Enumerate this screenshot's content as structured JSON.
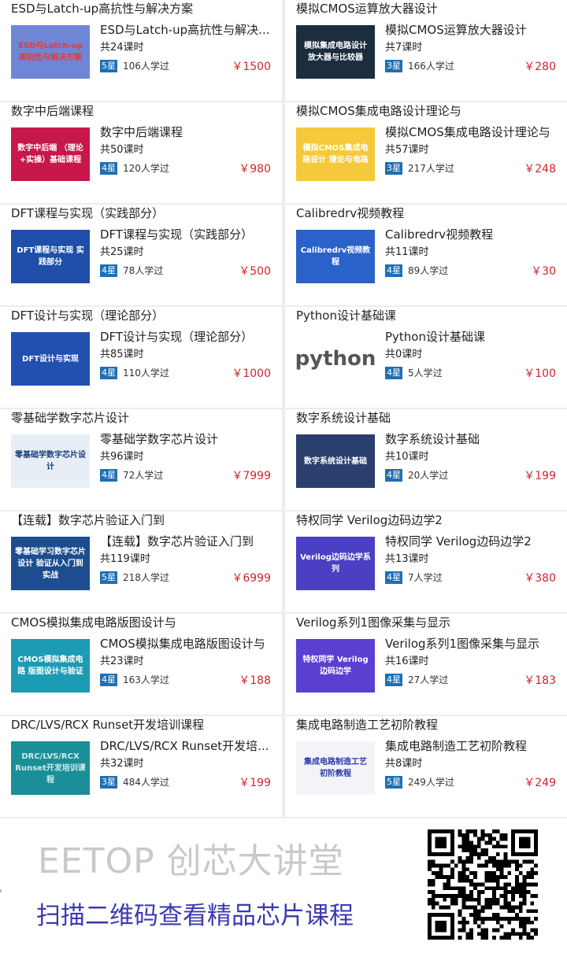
{
  "courses": [
    {
      "title": "ESD与Latch-up高抗性与解决方案",
      "name": "ESD与Latch-up高抗性与解决...",
      "lessons": "共24课时",
      "stars": "5星",
      "learners": "106人学过",
      "price": "￥1500",
      "thumb_text": "ESD与Latch-up 高抗性与解决方案",
      "thumb_bg": "#6f86d6",
      "thumb_color": "#e23b3b"
    },
    {
      "title": "模拟CMOS运算放大器设计",
      "name": "模拟CMOS运算放大器设计",
      "lessons": "共7课时",
      "stars": "3星",
      "learners": "166人学过",
      "price": "￥280",
      "thumb_text": "模拟集成电路设计 放大器与比较器",
      "thumb_bg": "#1b2d3e",
      "thumb_color": "#ffffff"
    },
    {
      "title": "数字中后端课程",
      "name": "数字中后端课程",
      "lessons": "共50课时",
      "stars": "4星",
      "learners": "120人学过",
      "price": "￥980",
      "thumb_text": "数字中后端 （理论+实操）基础课程",
      "thumb_bg": "#c8174a",
      "thumb_color": "#ffffff"
    },
    {
      "title": "模拟CMOS集成电路设计理论与",
      "name": "模拟CMOS集成电路设计理论与",
      "lessons": "共57课时",
      "stars": "3星",
      "learners": "217人学过",
      "price": "￥248",
      "thumb_text": "模拟CMOS集成电路设计 理论与电路",
      "thumb_bg": "#f6c93c",
      "thumb_color": "#ffffff"
    },
    {
      "title": "DFT课程与实现（实践部分）",
      "name": "DFT课程与实现（实践部分）",
      "lessons": "共25课时",
      "stars": "4星",
      "learners": "78人学过",
      "price": "￥500",
      "thumb_text": "DFT课程与实现 实践部分",
      "thumb_bg": "#1f4fa8",
      "thumb_color": "#ffffff"
    },
    {
      "title": "Calibredrv视频教程",
      "name": "Calibredrv视频教程",
      "lessons": "共11课时",
      "stars": "4星",
      "learners": "89人学过",
      "price": "￥30",
      "thumb_text": "Calibredrv视频教程",
      "thumb_bg": "#2a62c9",
      "thumb_color": "#ffffff"
    },
    {
      "title": "DFT设计与实现（理论部分）",
      "name": "DFT设计与实现（理论部分）",
      "lessons": "共85课时",
      "stars": "4星",
      "learners": "110人学过",
      "price": "￥1000",
      "thumb_text": "DFT设计与实现",
      "thumb_bg": "#2250b0",
      "thumb_color": "#ffffff"
    },
    {
      "title": "Python设计基础课",
      "name": "Python设计基础课",
      "lessons": "共0课时",
      "stars": "4星",
      "learners": "5人学过",
      "price": "￥100",
      "thumb_text": "python",
      "thumb_bg": "#ffffff",
      "thumb_color": "#555555"
    },
    {
      "title": "零基础学数字芯片设计",
      "name": "零基础学数字芯片设计",
      "lessons": "共96课时",
      "stars": "4星",
      "learners": "72人学过",
      "price": "￥7999",
      "thumb_text": "零基础学数字芯片设计",
      "thumb_bg": "#e8eef6",
      "thumb_color": "#1a3d7c"
    },
    {
      "title": "数字系统设计基础",
      "name": "数字系统设计基础",
      "lessons": "共10课时",
      "stars": "4星",
      "learners": "20人学过",
      "price": "￥199",
      "thumb_text": "数字系统设计基础",
      "thumb_bg": "#2a3f6e",
      "thumb_color": "#ffffff"
    },
    {
      "title": "【连载】数字芯片验证入门到",
      "name": "【连载】数字芯片验证入门到",
      "lessons": "共119课时",
      "stars": "5星",
      "learners": "218人学过",
      "price": "￥6999",
      "thumb_text": "零基础学习数字芯片设计 验证从入门到实战",
      "thumb_bg": "#1d4d8f",
      "thumb_color": "#ffffff"
    },
    {
      "title": "特权同学 Verilog边码边学2",
      "name": "特权同学 Verilog边码边学2",
      "lessons": "共13课时",
      "stars": "4星",
      "learners": "7人学过",
      "price": "￥380",
      "thumb_text": "Verilog边码边学系列",
      "thumb_bg": "#4b3fc4",
      "thumb_color": "#ffffff"
    },
    {
      "title": "CMOS模拟集成电路版图设计与",
      "name": "CMOS模拟集成电路版图设计与",
      "lessons": "共23课时",
      "stars": "4星",
      "learners": "163人学过",
      "price": "￥188",
      "thumb_text": "CMOS模拟集成电路 版图设计与验证",
      "thumb_bg": "#1c9bb4",
      "thumb_color": "#ffffff"
    },
    {
      "title": "Verilog系列1图像采集与显示",
      "name": "Verilog系列1图像采集与显示",
      "lessons": "共16课时",
      "stars": "4星",
      "learners": "27人学过",
      "price": "￥183",
      "thumb_text": "特权同学 Verilog边码边学",
      "thumb_bg": "#5a3fd0",
      "thumb_color": "#ffffff"
    },
    {
      "title": "DRC/LVS/RCX Runset开发培训课程",
      "name": "DRC/LVS/RCX Runset开发培...",
      "lessons": "共32课时",
      "stars": "3星",
      "learners": "484人学过",
      "price": "￥199",
      "thumb_text": "DRC/LVS/RCX Runset开发培训课程",
      "thumb_bg": "#1a8f97",
      "thumb_color": "#cfe9ee"
    },
    {
      "title": "集成电路制造工艺初阶教程",
      "name": "集成电路制造工艺初阶教程",
      "lessons": "共8课时",
      "stars": "5星",
      "learners": "249人学过",
      "price": "￥249",
      "thumb_text": "集成电路制造工艺 初阶教程",
      "thumb_bg": "#f3f4f8",
      "thumb_color": "#2c3aa8"
    }
  ],
  "footer": {
    "brand": "EETOP 创芯大讲堂",
    "slogan": "扫描二维码查看精品芯片课程",
    "qr_icon": "qr-code-icon"
  },
  "colors": {
    "price": "#d0262a",
    "badge": "#1f6fb3",
    "slogan": "#3a3ab0",
    "brand": "#c9c9c9"
  }
}
